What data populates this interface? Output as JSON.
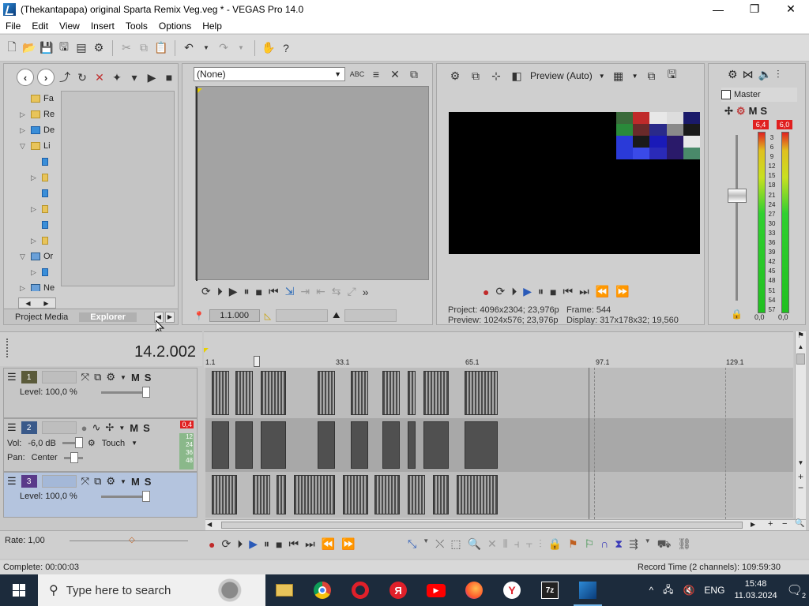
{
  "window": {
    "title": "(Thekantapapa) original Sparta Remix Veg.veg * - VEGAS Pro 14.0",
    "minimize": "—",
    "maximize": "❐",
    "close": "✕"
  },
  "menu": [
    "File",
    "Edit",
    "View",
    "Insert",
    "Tools",
    "Options",
    "Help"
  ],
  "explorer": {
    "tabs": {
      "project_media": "Project Media",
      "explorer": "Explorer"
    },
    "tree": [
      {
        "label": "Fa",
        "tri": ""
      },
      {
        "label": "Re",
        "tri": "▷"
      },
      {
        "label": "De",
        "tri": "▷"
      },
      {
        "label": "Li",
        "tri": "▽"
      },
      {
        "label": "",
        "tri": ""
      },
      {
        "label": "",
        "tri": "▷"
      },
      {
        "label": "",
        "tri": ""
      },
      {
        "label": "",
        "tri": "▷"
      },
      {
        "label": "",
        "tri": ""
      },
      {
        "label": "",
        "tri": "▷"
      },
      {
        "label": "Or",
        "tri": "▽"
      },
      {
        "label": "",
        "tri": "▷"
      },
      {
        "label": "Ne",
        "tri": "▷"
      }
    ]
  },
  "trimmer": {
    "selected": "(None)",
    "position": "1.1.000"
  },
  "preview": {
    "quality": "Preview (Auto)",
    "project_label": "Project:",
    "project_value": "4096x2304; 23,976p",
    "frame_label": "Frame:",
    "frame_value": "544",
    "preview_label": "Preview:",
    "preview_value": "1024x576; 23,976p",
    "display_label": "Display:",
    "display_value": "317x178x32; 19,560"
  },
  "master": {
    "label": "Master",
    "peak_left": "6,4",
    "peak_right": "6,0",
    "foot_left": "0,0",
    "foot_right": "0,0",
    "scale": [
      "3",
      "6",
      "9",
      "12",
      "15",
      "18",
      "21",
      "24",
      "27",
      "30",
      "33",
      "36",
      "39",
      "42",
      "45",
      "48",
      "51",
      "54",
      "57"
    ]
  },
  "timeline": {
    "timecode": "14.2.002",
    "ruler": [
      "1.1",
      "33.1",
      "65.1",
      "97.1",
      "129.1"
    ],
    "tracks": [
      {
        "num": "1",
        "level": "Level: 100,0 %"
      },
      {
        "num": "2",
        "vol_label": "Vol:",
        "vol": "-6,0 dB",
        "pan_label": "Pan:",
        "pan": "Center",
        "automation": "Touch",
        "peak": "0,4",
        "meter": [
          "12",
          "24",
          "36",
          "48"
        ]
      },
      {
        "num": "3",
        "level": "Level: 100,0 %"
      }
    ]
  },
  "transport_rate": "Rate: 1,00",
  "status": {
    "complete": "Complete: 00:00:03",
    "record_time": "Record Time (2 channels): 109:59:30"
  },
  "taskbar": {
    "search_placeholder": "Type here to search",
    "lang": "ENG",
    "time": "15:48",
    "date": "11.03.2024",
    "notifications": "2"
  }
}
